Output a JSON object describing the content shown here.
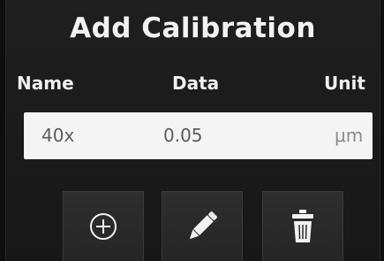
{
  "dialog": {
    "title": "Add Calibration"
  },
  "table": {
    "columns": {
      "name": "Name",
      "data": "Data",
      "unit": "Unit"
    },
    "rows": [
      {
        "name": "40x",
        "data": "0.05",
        "unit": "μm"
      }
    ]
  },
  "toolbar": {
    "add_icon": "circle-plus-icon",
    "edit_icon": "pencil-icon",
    "delete_icon": "trash-icon"
  },
  "colors": {
    "background": "#1c1c1c",
    "text": "#f0f0f0",
    "row_background": "#f4f4f4",
    "button": "#2a2a2a"
  }
}
